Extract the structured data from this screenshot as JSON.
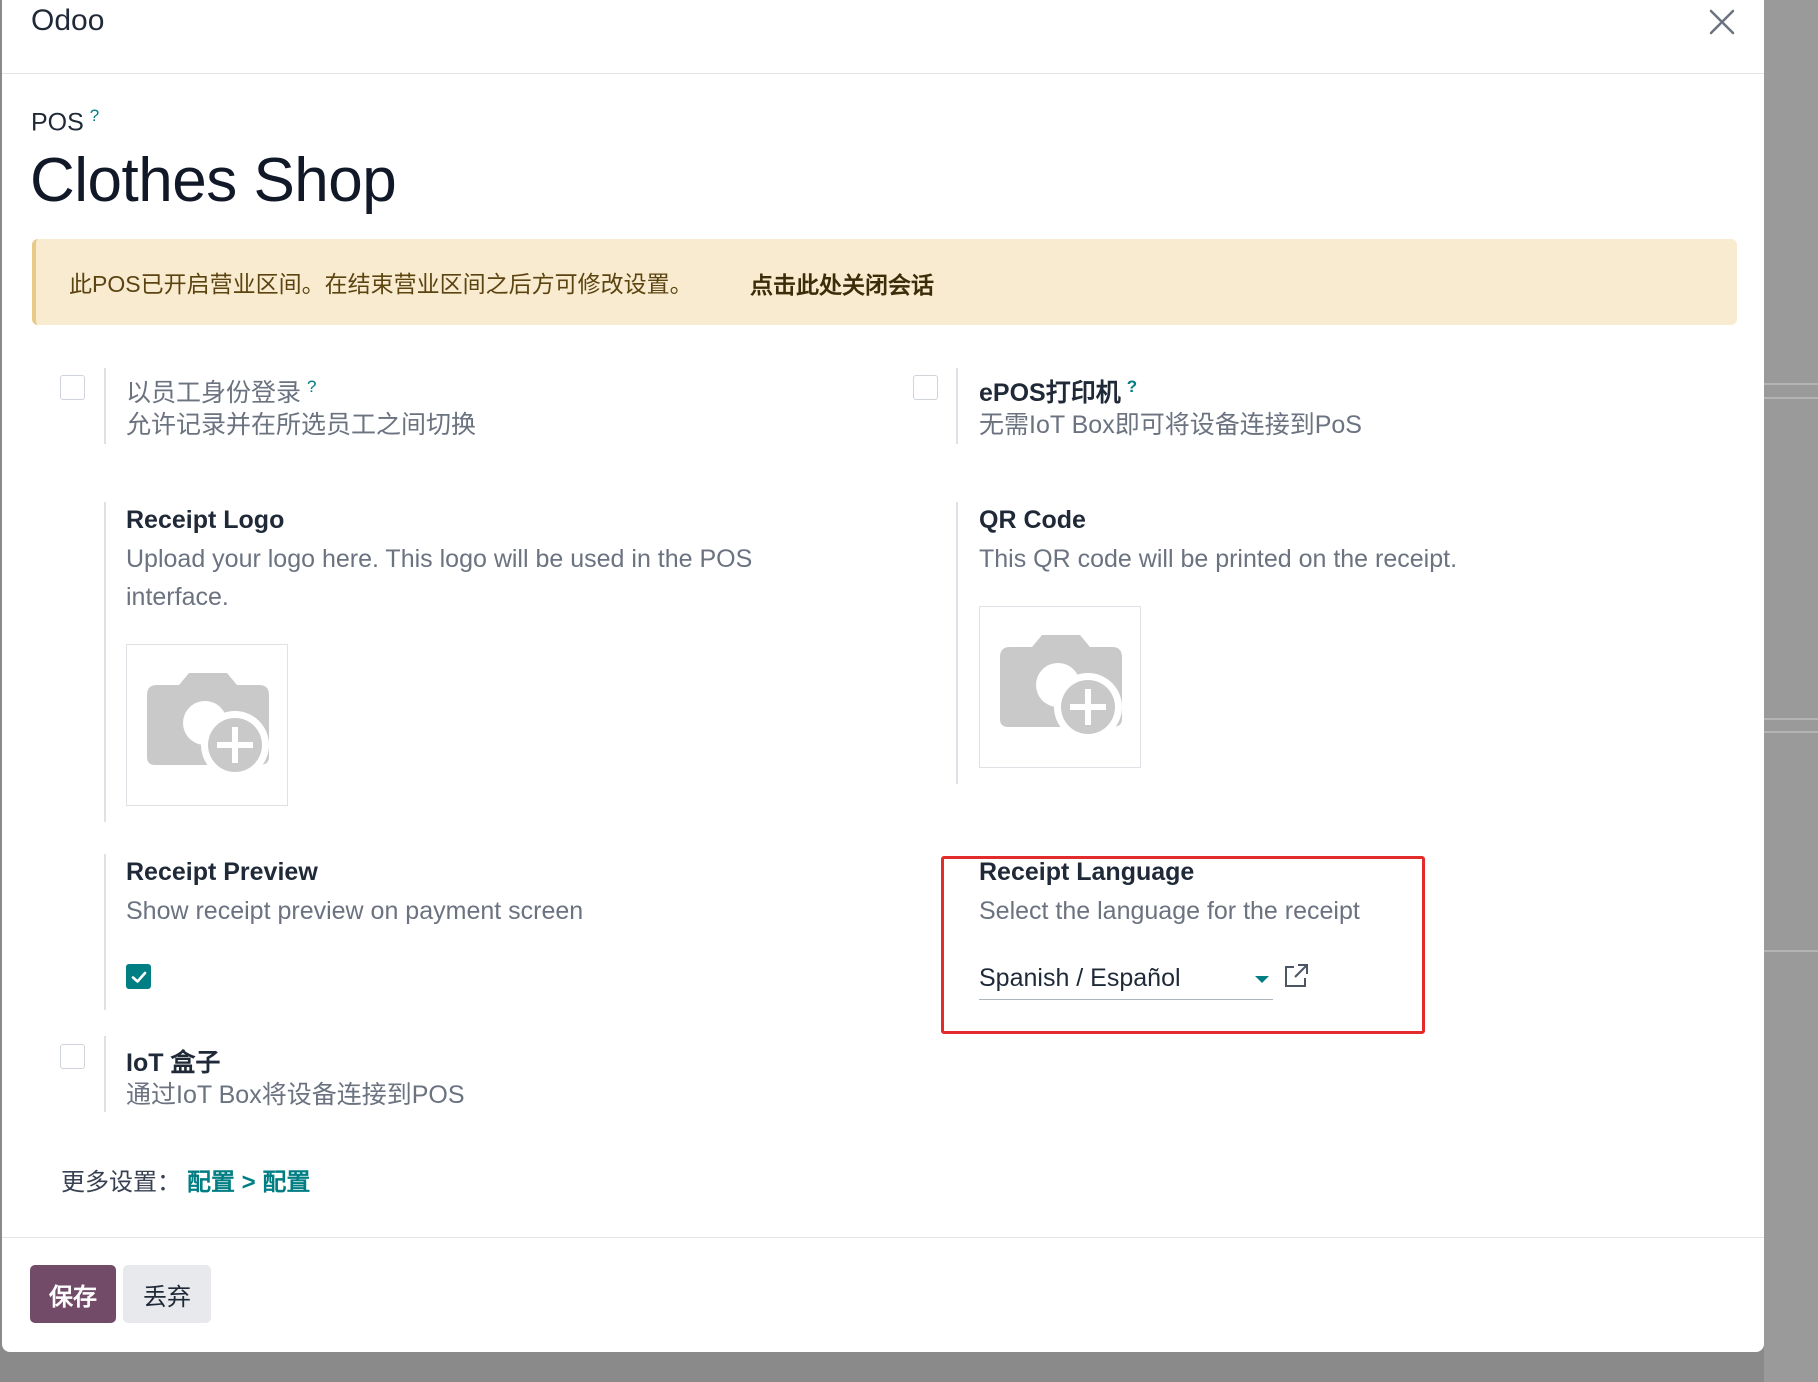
{
  "dialog": {
    "title": "Odoo"
  },
  "header": {
    "pos_label": "POS",
    "help_mark": "?",
    "shop_name": "Clothes Shop"
  },
  "alert": {
    "message": "此POS已开启营业区间。在结束营业区间之后方可修改设置。",
    "link_label": "点击此处关闭会话"
  },
  "settings": {
    "employee_login": {
      "title": "以员工身份登录",
      "help": "?",
      "description": "允许记录并在所选员工之间切换",
      "checked": false
    },
    "epos_printer": {
      "title": "ePOS打印机",
      "help": "?",
      "description": "无需IoT Box即可将设备连接到PoS",
      "checked": false
    },
    "receipt_logo": {
      "title": "Receipt Logo",
      "description_line1": "Upload your logo here. This logo will be used in the POS",
      "description_line2": "interface."
    },
    "qr_code": {
      "title": "QR Code",
      "description": "This QR code will be printed on the receipt."
    },
    "receipt_preview": {
      "title": "Receipt Preview",
      "description": "Show receipt preview on payment screen",
      "checked": true
    },
    "receipt_language": {
      "title": "Receipt Language",
      "description": "Select the language for the receipt",
      "selected": "Spanish / Español"
    },
    "iot_box": {
      "title": "IoT 盒子",
      "description": "通过IoT Box将设备连接到POS",
      "checked": false
    }
  },
  "more_settings": {
    "label": "更多设置：",
    "link": "配置 > 配置"
  },
  "footer": {
    "save_label": "保存",
    "discard_label": "丢弃"
  },
  "colors": {
    "primary": "#714b67",
    "accent": "#017e84",
    "alert_bg": "#f9ebd0",
    "highlight": "#e32b2b"
  },
  "icons": [
    "close-icon",
    "camera-plus-icon",
    "check-icon",
    "caret-down-icon",
    "external-link-icon"
  ]
}
